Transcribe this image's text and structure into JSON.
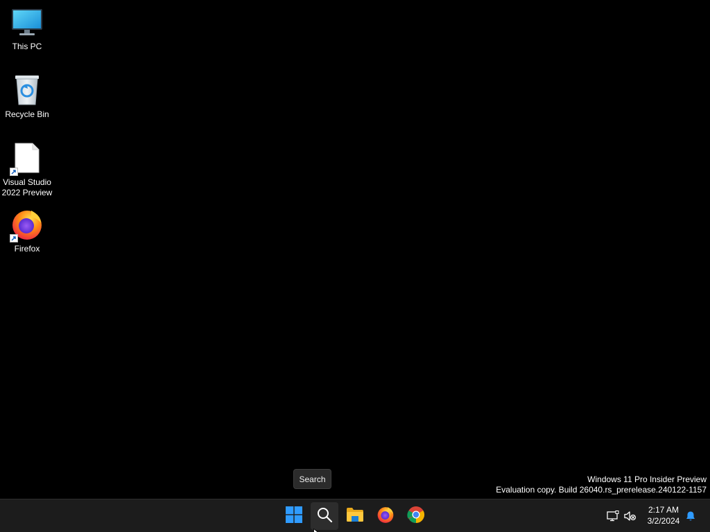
{
  "desktop": {
    "icons": [
      {
        "label": "This PC",
        "icon": "monitor-icon"
      },
      {
        "label": "Recycle Bin",
        "icon": "recycle-bin-icon"
      },
      {
        "label": "Visual Studio 2022 Preview",
        "icon": "blank-file-icon",
        "shortcut": true
      },
      {
        "label": "Firefox",
        "icon": "firefox-icon",
        "shortcut": true
      }
    ]
  },
  "tooltip": {
    "text": "Search"
  },
  "watermark": {
    "line1": "Windows 11 Pro Insider Preview",
    "line2": "Evaluation copy. Build 26040.rs_prerelease.240122-1157"
  },
  "taskbar": {
    "buttons": [
      {
        "name": "start",
        "icon": "windows-logo-icon"
      },
      {
        "name": "search",
        "icon": "search-icon",
        "hovered": true
      },
      {
        "name": "file-explorer",
        "icon": "folder-icon"
      },
      {
        "name": "firefox",
        "icon": "firefox-icon"
      },
      {
        "name": "chrome",
        "icon": "chrome-icon"
      }
    ],
    "tray": {
      "time": "2:17 AM",
      "date": "3/2/2024"
    }
  },
  "colors": {
    "taskbar_bg": "#1c1c1c",
    "desktop_bg": "#000000",
    "windows_blue": "#2f9bff"
  }
}
